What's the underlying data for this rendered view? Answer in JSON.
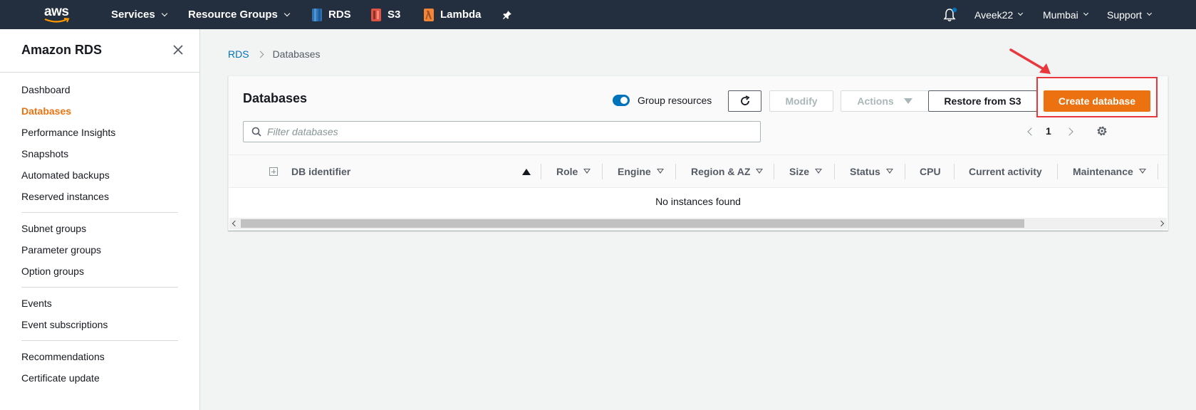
{
  "topnav": {
    "logo_text": "aws",
    "services": "Services",
    "resource_groups": "Resource Groups",
    "pinned": [
      {
        "label": "RDS",
        "color": "#2e73b8"
      },
      {
        "label": "S3",
        "color": "#e05243"
      },
      {
        "label": "Lambda",
        "color": "#f58536"
      }
    ],
    "user": "Aveek22",
    "region": "Mumbai",
    "support": "Support",
    "notification_badge_color": "#0073bb"
  },
  "sidebar": {
    "title": "Amazon RDS",
    "items": [
      {
        "label": "Dashboard"
      },
      {
        "label": "Databases",
        "active": true
      },
      {
        "label": "Performance Insights"
      },
      {
        "label": "Snapshots"
      },
      {
        "label": "Automated backups"
      },
      {
        "label": "Reserved instances"
      },
      {
        "label": "Subnet groups"
      },
      {
        "label": "Parameter groups"
      },
      {
        "label": "Option groups"
      },
      {
        "label": "Events"
      },
      {
        "label": "Event subscriptions"
      },
      {
        "label": "Recommendations"
      },
      {
        "label": "Certificate update"
      }
    ]
  },
  "breadcrumb": {
    "root": "RDS",
    "current": "Databases"
  },
  "panel": {
    "title": "Databases",
    "group_resources_label": "Group resources",
    "group_resources_on": true,
    "modify_label": "Modify",
    "actions_label": "Actions",
    "restore_label": "Restore from S3",
    "create_label": "Create database",
    "filter_placeholder": "Filter databases",
    "page_number": "1",
    "columns": [
      "DB identifier",
      "Role",
      "Engine",
      "Region & AZ",
      "Size",
      "Status",
      "CPU",
      "Current activity",
      "Maintenance"
    ],
    "empty_message": "No instances found"
  },
  "colors": {
    "accent": "#ec7211",
    "link": "#0073bb",
    "nav_bg": "#232f3e",
    "highlight": "#e8383d"
  }
}
